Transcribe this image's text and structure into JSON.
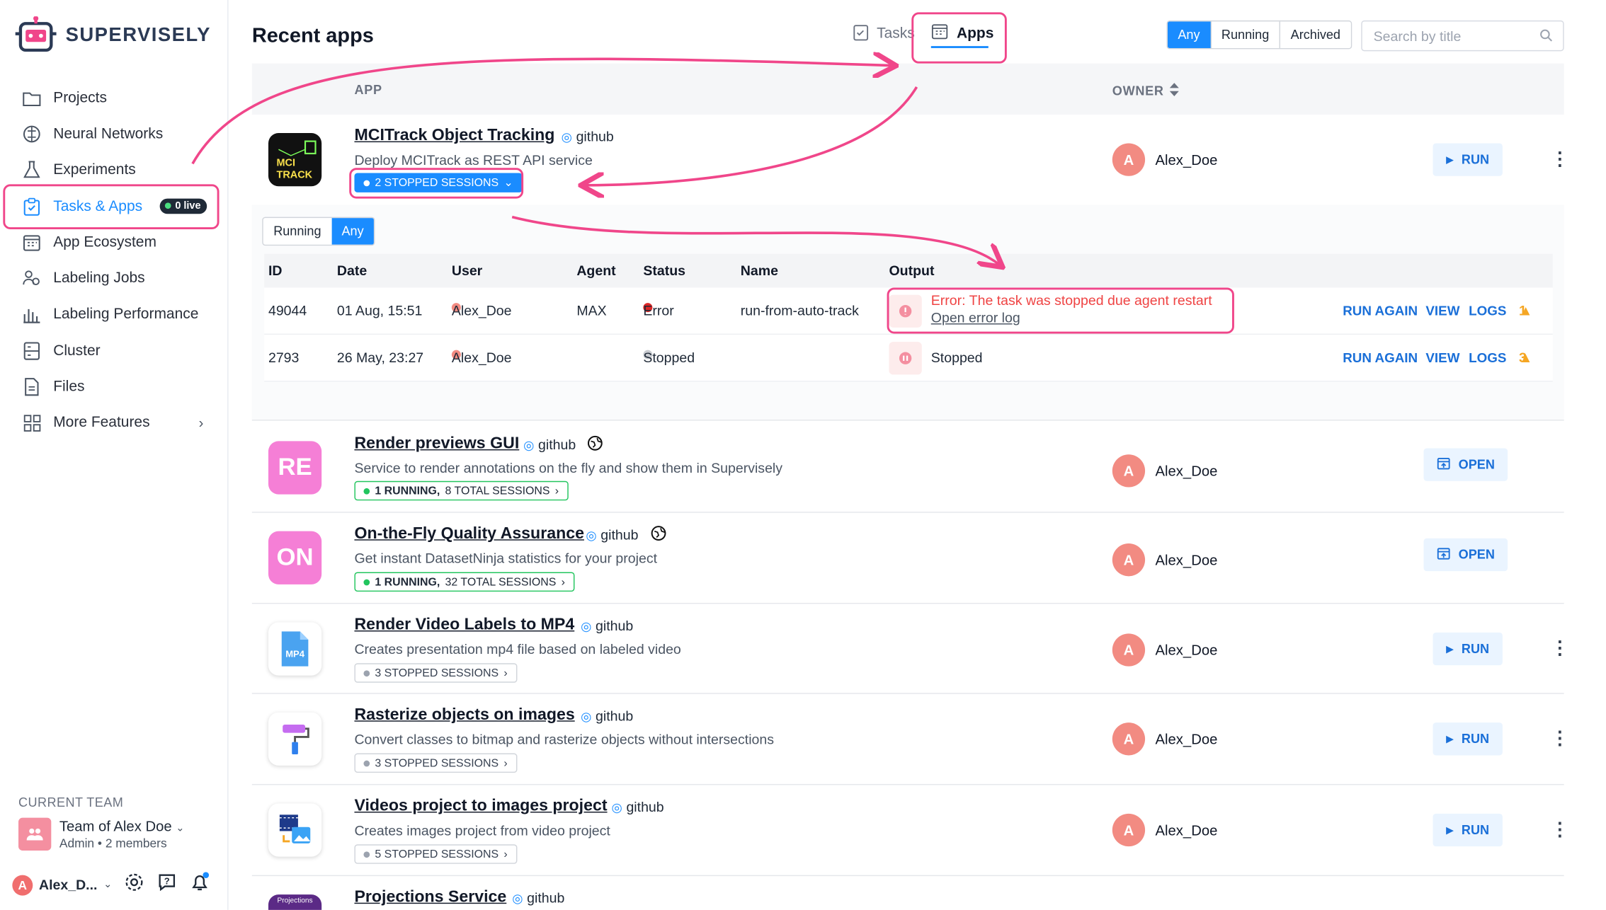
{
  "brand": {
    "name": "SUPERVISELY"
  },
  "sidebar": {
    "items": [
      {
        "label": "Projects"
      },
      {
        "label": "Neural Networks"
      },
      {
        "label": "Experiments"
      },
      {
        "label": "Tasks & Apps",
        "badge": "0 live"
      },
      {
        "label": "App Ecosystem"
      },
      {
        "label": "Labeling Jobs"
      },
      {
        "label": "Labeling Performance"
      },
      {
        "label": "Cluster"
      },
      {
        "label": "Files"
      },
      {
        "label": "More Features"
      }
    ],
    "team_label": "CURRENT TEAM",
    "team_name": "Team of Alex Doe",
    "team_role": "Admin",
    "team_members": "2 members",
    "user_name": "Alex_D...",
    "user_initial": "A"
  },
  "header": {
    "title": "Recent apps",
    "tab_tasks": "Tasks",
    "tab_apps": "Apps",
    "filters": [
      "Any",
      "Running",
      "Archived"
    ],
    "search_placeholder": "Search by title"
  },
  "table": {
    "col_app": "APP",
    "col_owner": "OWNER"
  },
  "apps": [
    {
      "name": "MCITrack Object Tracking",
      "source": "github",
      "description": "Deploy MCITrack as REST API service",
      "sessions": "2 STOPPED SESSIONS",
      "owner": "Alex_Doe",
      "owner_initial": "A",
      "action": "RUN",
      "icon_text": "MCI\nTRACK"
    },
    {
      "name": "Render previews GUI",
      "source": "github",
      "description": "Service to render annotations on the fly and show them in Supervisely",
      "sessions_strong": "1 RUNNING,",
      "sessions": "8 TOTAL SESSIONS",
      "owner": "Alex_Doe",
      "owner_initial": "A",
      "action": "OPEN",
      "icon_text": "RE"
    },
    {
      "name": "On-the-Fly Quality Assurance",
      "source": "github",
      "description": "Get instant DatasetNinja statistics for your project",
      "sessions_strong": "1 RUNNING,",
      "sessions": "32 TOTAL SESSIONS",
      "owner": "Alex_Doe",
      "owner_initial": "A",
      "action": "OPEN",
      "icon_text": "ON"
    },
    {
      "name": "Render Video Labels to MP4",
      "source": "github",
      "description": "Creates presentation mp4 file based on labeled video",
      "sessions": "3 STOPPED SESSIONS",
      "owner": "Alex_Doe",
      "owner_initial": "A",
      "action": "RUN",
      "icon_text": "MP4"
    },
    {
      "name": "Rasterize objects on images",
      "source": "github",
      "description": "Convert classes to bitmap and rasterize objects without intersections",
      "sessions": "3 STOPPED SESSIONS",
      "owner": "Alex_Doe",
      "owner_initial": "A",
      "action": "RUN"
    },
    {
      "name": "Videos project to images project",
      "source": "github",
      "description": "Creates images project from video project",
      "sessions": "5 STOPPED SESSIONS",
      "owner": "Alex_Doe",
      "owner_initial": "A",
      "action": "RUN"
    },
    {
      "name": "Projections Service",
      "source": "github",
      "icon_text": "Projections"
    }
  ],
  "sessions_panel": {
    "filters": [
      "Running",
      "Any"
    ],
    "columns": [
      "ID",
      "Date",
      "User",
      "Agent",
      "Status",
      "Name",
      "Output"
    ],
    "rows": [
      {
        "id": "49044",
        "date": "01 Aug, 15:51",
        "user": "Alex_Doe",
        "agent": "MAX",
        "status": "Error",
        "name": "run-from-auto-track",
        "output": "Error: The task was stopped due agent restart",
        "output_link": "Open error log",
        "warnings": "1"
      },
      {
        "id": "2793",
        "date": "26 May, 23:27",
        "user": "Alex_Doe",
        "agent": "",
        "status": "Stopped",
        "name": "",
        "output": "Stopped",
        "warnings": "3"
      }
    ],
    "actions": [
      "RUN AGAIN",
      "VIEW",
      "LOGS"
    ]
  },
  "colors": {
    "accent": "#1a8cff",
    "highlight": "#f0468a",
    "error": "#ef4444",
    "running": "#22c55e"
  }
}
